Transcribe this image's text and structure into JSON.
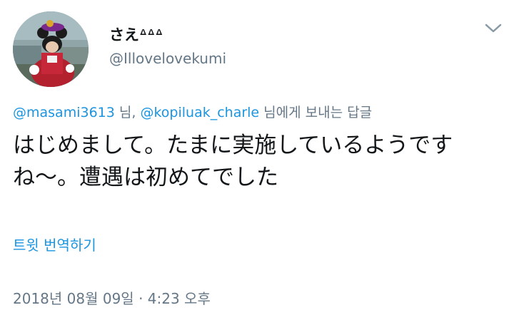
{
  "author": {
    "display_name": "さえᐞᐞᐞ",
    "handle": "@Illovelovekumi"
  },
  "icons": {
    "avatar": "profile-photo",
    "more": "chevron-down-icon"
  },
  "reply_context": {
    "mention_1": "@masami3613",
    "sep_1": " 님, ",
    "mention_2": "@kopiluak_charle",
    "suffix": " 님에게 보내는 답글"
  },
  "tweet": {
    "text": "はじめまして。たまに実施しているようですね〜。遭遇は初めてでした"
  },
  "translate_label": "트윗 번역하기",
  "timestamp": "2018년 08월 09일 · 4:23 오후",
  "colors": {
    "link": "#1b95e0",
    "secondary": "#657786",
    "text": "#14171a"
  }
}
